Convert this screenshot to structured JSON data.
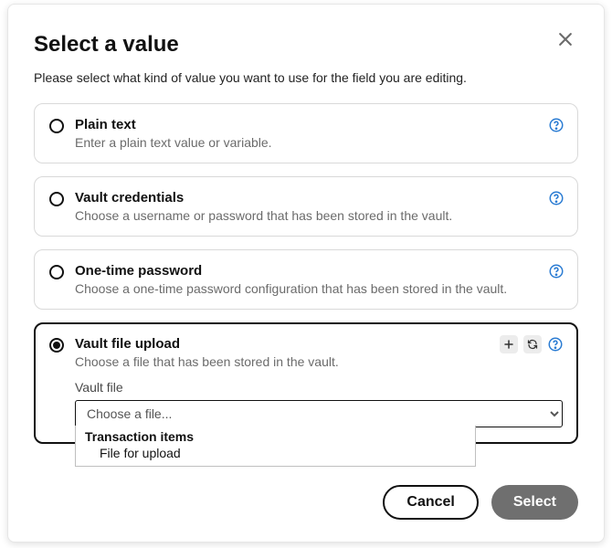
{
  "modal": {
    "title": "Select a value",
    "subtitle": "Please select what kind of value you want to use for the field you are editing.",
    "options": {
      "plain": {
        "title": "Plain text",
        "desc": "Enter a plain text value or variable."
      },
      "vault_creds": {
        "title": "Vault credentials",
        "desc": "Choose a username or password that has been stored in the vault."
      },
      "otp": {
        "title": "One-time password",
        "desc": "Choose a one-time password configuration that has been stored in the vault."
      },
      "file": {
        "title": "Vault file upload",
        "desc": "Choose a file that has been stored in the vault."
      }
    },
    "file_section": {
      "label": "Vault file",
      "placeholder": "Choose a file...",
      "dropdown": {
        "group": "Transaction items",
        "item": "File for upload"
      }
    },
    "buttons": {
      "cancel": "Cancel",
      "select": "Select"
    }
  }
}
